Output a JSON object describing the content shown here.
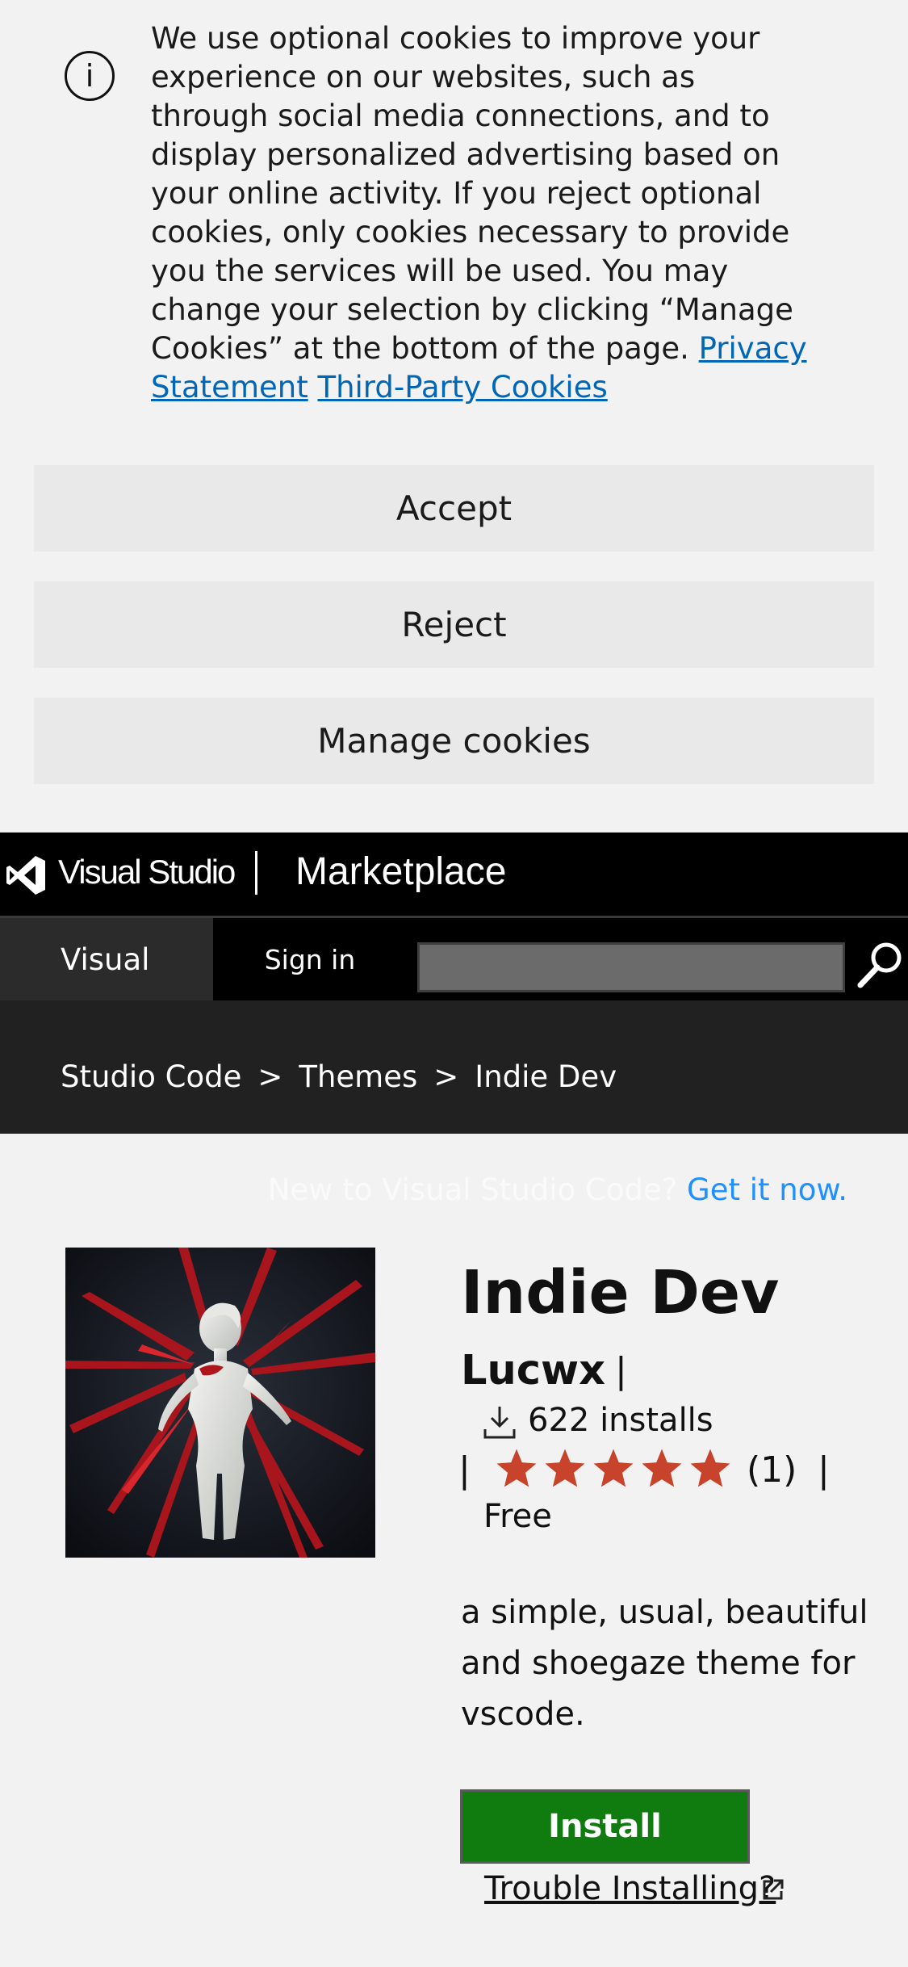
{
  "cookie_banner": {
    "text": "We use optional cookies to improve your experience on our websites, such as through social media connections, and to display personalized advertising based on your online activity. If you reject optional cookies, only cookies necessary to provide you the services will be used. You may change your selection by clicking “Manage Cookies” at the bottom of the page.",
    "privacy_link": "Privacy Statement",
    "third_party_link": "Third-Party Cookies",
    "accept_label": "Accept",
    "reject_label": "Reject",
    "manage_label": "Manage cookies",
    "info_icon": "info-icon"
  },
  "header": {
    "brand": "Visual Studio",
    "site": "Marketplace",
    "nav_visual": "Visual",
    "sign_in": "Sign in",
    "search_placeholder": "",
    "search_icon": "search-icon"
  },
  "breadcrumb": {
    "items": [
      "Studio Code",
      "Themes",
      "Indie Dev"
    ],
    "separator": ">"
  },
  "promo": {
    "text": "New to Visual Studio Code?",
    "link": "Get it now."
  },
  "extension": {
    "name": "Indie Dev",
    "publisher": "Lucwx",
    "installs": "622 installs",
    "rating_count": "(1)",
    "rating_stars": 5,
    "price": "Free",
    "description": "a simple, usual, beautiful and shoegaze theme for vscode.",
    "install_label": "Install",
    "trouble_label": "Trouble Installing?",
    "pipe": "|"
  },
  "colors": {
    "accent_link": "#0067b8",
    "install_green": "#107c10",
    "star": "#c8432b"
  }
}
